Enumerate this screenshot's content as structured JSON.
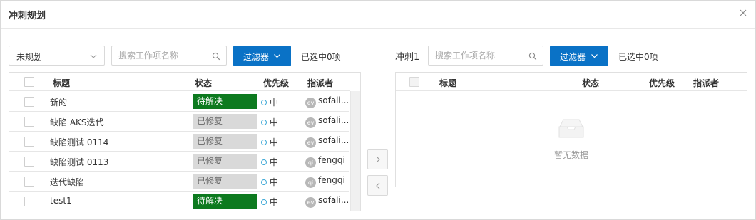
{
  "dialog": {
    "title": "冲刺规划"
  },
  "left": {
    "select_value": "未规划",
    "search_placeholder": "搜索工作项名称",
    "filter_label": "过滤器",
    "selected_count": "已选中0项",
    "columns": {
      "title": "标题",
      "status": "状态",
      "priority": "优先级",
      "assignee": "指派者"
    },
    "rows": [
      {
        "title": "新的",
        "status": "待解决",
        "status_type": "pending",
        "priority": "中",
        "avatar": "ev",
        "assignee": "sofali..."
      },
      {
        "title": "缺陷 AKS迭代",
        "status": "已修复",
        "status_type": "fixed",
        "priority": "中",
        "avatar": "ev",
        "assignee": "sofali..."
      },
      {
        "title": "缺陷测试 0114",
        "status": "已修复",
        "status_type": "fixed",
        "priority": "中",
        "avatar": "ev",
        "assignee": "sofali..."
      },
      {
        "title": "缺陷测试 0113",
        "status": "已修复",
        "status_type": "fixed",
        "priority": "中",
        "avatar": "qi",
        "assignee": "fengqi"
      },
      {
        "title": "迭代缺陷",
        "status": "已修复",
        "status_type": "fixed",
        "priority": "中",
        "avatar": "qi",
        "assignee": "fengqi"
      },
      {
        "title": "test1",
        "status": "待解决",
        "status_type": "pending",
        "priority": "中",
        "avatar": "ev",
        "assignee": "sofali..."
      }
    ]
  },
  "right": {
    "sprint_label": "冲刺1",
    "search_placeholder": "搜索工作项名称",
    "filter_label": "过滤器",
    "selected_count": "已选中0项",
    "columns": {
      "title": "标题",
      "status": "状态",
      "priority": "优先级",
      "assignee": "指派者"
    },
    "empty_text": "暂无数据"
  },
  "colors": {
    "primary": "#0a72c6",
    "status_pending": "#0d7a1f",
    "status_fixed": "#d9d9d9",
    "priority_dot": "#3ca8d6"
  },
  "icons": {
    "close": "close-icon",
    "chevron": "chevron-down-icon",
    "search": "search-icon",
    "move_right": "chevron-right-icon",
    "move_left": "chevron-left-icon",
    "empty": "empty-inbox-icon"
  }
}
